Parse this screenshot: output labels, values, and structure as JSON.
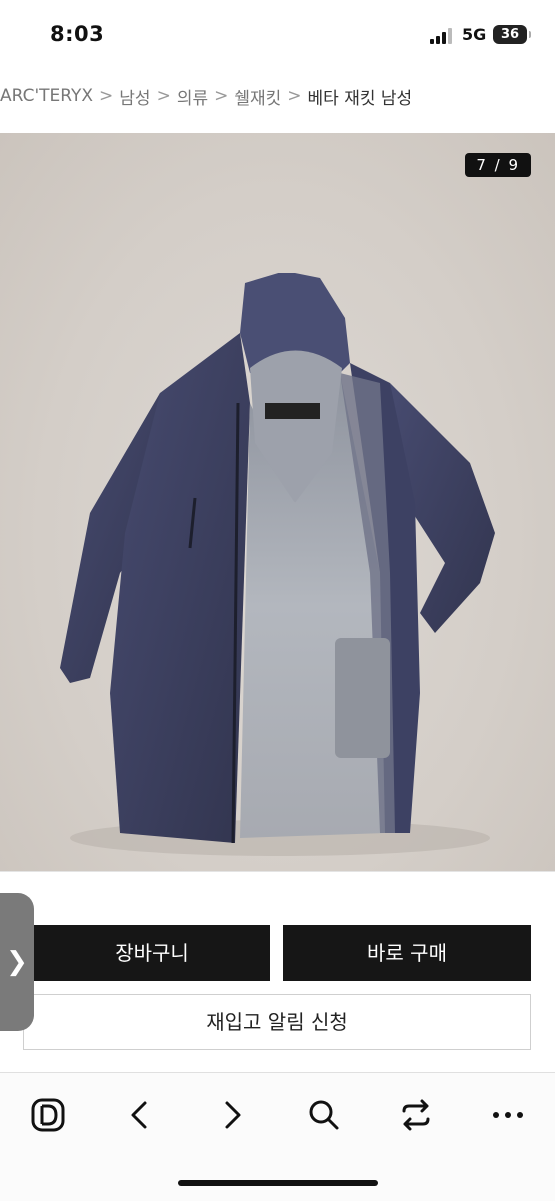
{
  "status_bar": {
    "time": "8:03",
    "network": "5G",
    "battery": "36"
  },
  "breadcrumb": {
    "items": [
      "ARC'TERYX",
      "남성",
      "의류",
      "쉘재킷"
    ],
    "current": "베타 재킷 남성",
    "separator": ">"
  },
  "gallery": {
    "counter": "7 / 9"
  },
  "actions": {
    "cart_label": "장바구니",
    "buy_now_label": "바로 구매",
    "restock_label": "재입고 알림 신청",
    "side_tab_icon": "chevron-right"
  },
  "browser_toolbar": {
    "icons": [
      "app-logo-d",
      "back-arrow",
      "forward-arrow",
      "search",
      "share",
      "more"
    ]
  },
  "colors": {
    "button_dark": "#161616",
    "jacket_navy": "#3b3f62",
    "background_beige": "#d6d0ca"
  }
}
